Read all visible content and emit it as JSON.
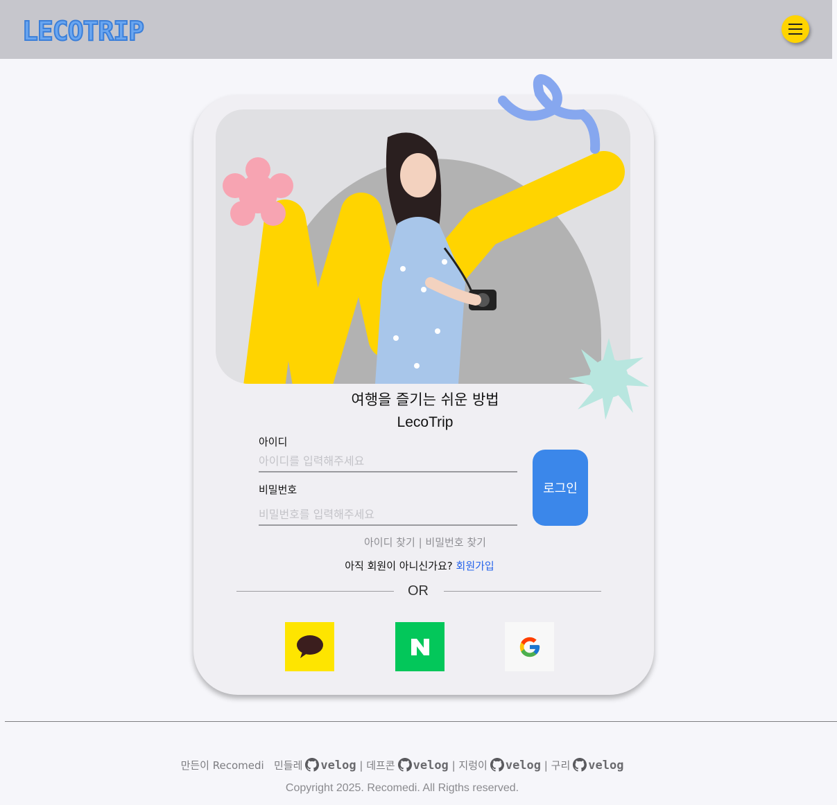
{
  "header": {
    "logo_text": "LECOTRIP",
    "menu_icon": "hamburger-icon",
    "brand_colors": {
      "blue": "#4a90e2",
      "yellow": "#ffd400"
    }
  },
  "hero": {
    "tagline": "여행을 즐기는 쉬운 방법",
    "brand": "LecoTrip"
  },
  "login_form": {
    "id_label": "아이디",
    "id_placeholder": "아이디를 입력해주세요",
    "id_value": "",
    "password_label": "비밀번호",
    "password_placeholder": "비밀번호를 입력해주세요",
    "password_value": "",
    "login_button": "로그인",
    "find_id": "아이디 찾기",
    "find_separator": "|",
    "find_password": "비밀번호 찾기",
    "signup_prompt": "아직 회원이 아니신가요?",
    "signup_link": "회원가입",
    "or_text": "OR"
  },
  "social_login": [
    {
      "provider": "kakao",
      "icon": "kakao-speech-bubble-icon",
      "color": "#fee500"
    },
    {
      "provider": "naver",
      "icon": "naver-n-icon",
      "color": "#03c75a"
    },
    {
      "provider": "google",
      "icon": "google-g-icon",
      "color": "#f8f8f8"
    }
  ],
  "footer": {
    "made_by": "만든이 Recomedi",
    "members": [
      {
        "name": "민들레",
        "link": "velog",
        "separator": "|"
      },
      {
        "name": "데프콘",
        "link": "velog",
        "separator": "|"
      },
      {
        "name": "지렁이",
        "link": "velog",
        "separator": "|"
      },
      {
        "name": "구리",
        "link": "velog",
        "separator": ""
      }
    ],
    "copyright": "Copyright 2025. Recomedi. All Rigths reserved."
  }
}
